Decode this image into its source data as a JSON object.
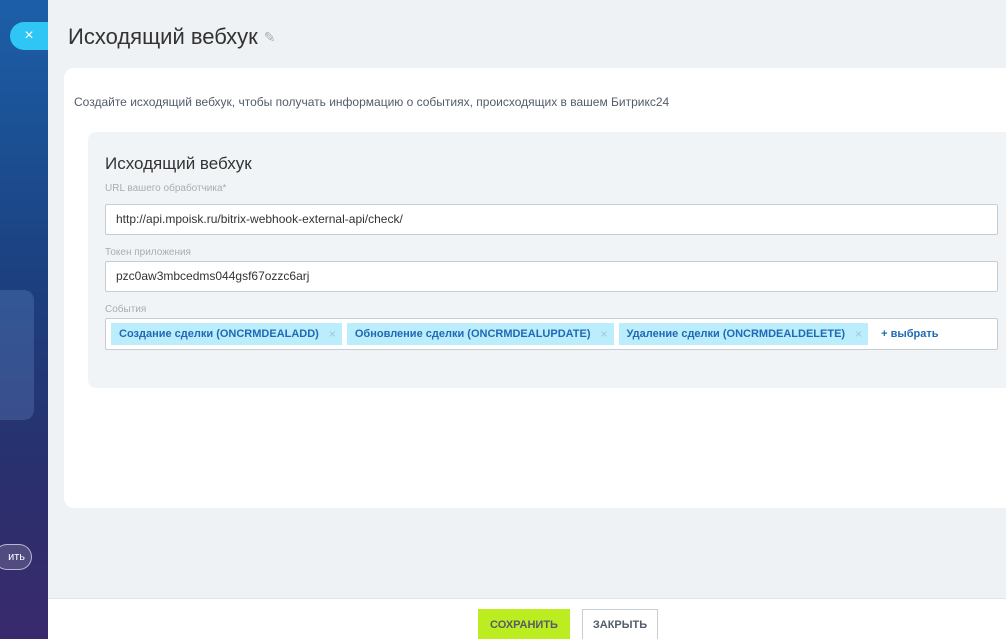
{
  "backdrop": {
    "stub_button_label": "ить"
  },
  "close_button": {
    "icon": "close-icon",
    "symbol": "×"
  },
  "panel": {
    "title": "Исходящий вебхук",
    "edit_icon": "pencil-icon",
    "description": "Создайте исходящий вебхук, чтобы получать информацию о событиях, происходящих в вашем Битрикс24"
  },
  "form": {
    "section_title": "Исходящий вебхук",
    "handler_url": {
      "label": "URL вашего обработчика*",
      "value": "http://api.mpoisk.ru/bitrix-webhook-external-api/check/"
    },
    "app_token": {
      "label": "Токен приложения",
      "value": "pzc0aw3mbcedms044gsf67ozzc6arj"
    },
    "events": {
      "label": "События",
      "tags": [
        {
          "label": "Создание сделки (ONCRMDEALADD)",
          "remove": "×"
        },
        {
          "label": "Обновление сделки (ONCRMDEALUPDATE)",
          "remove": "×"
        },
        {
          "label": "Удаление сделки (ONCRMDEALDELETE)",
          "remove": "×"
        }
      ],
      "add_label": "+ выбрать"
    }
  },
  "footer": {
    "save_label": "СОХРАНИТЬ",
    "close_label": "ЗАКРЫТЬ"
  },
  "colors": {
    "accent": "#2fc6f6",
    "save_green": "#bbed21",
    "tag_bg": "#bcedfc",
    "tag_text": "#1f6ab5"
  }
}
